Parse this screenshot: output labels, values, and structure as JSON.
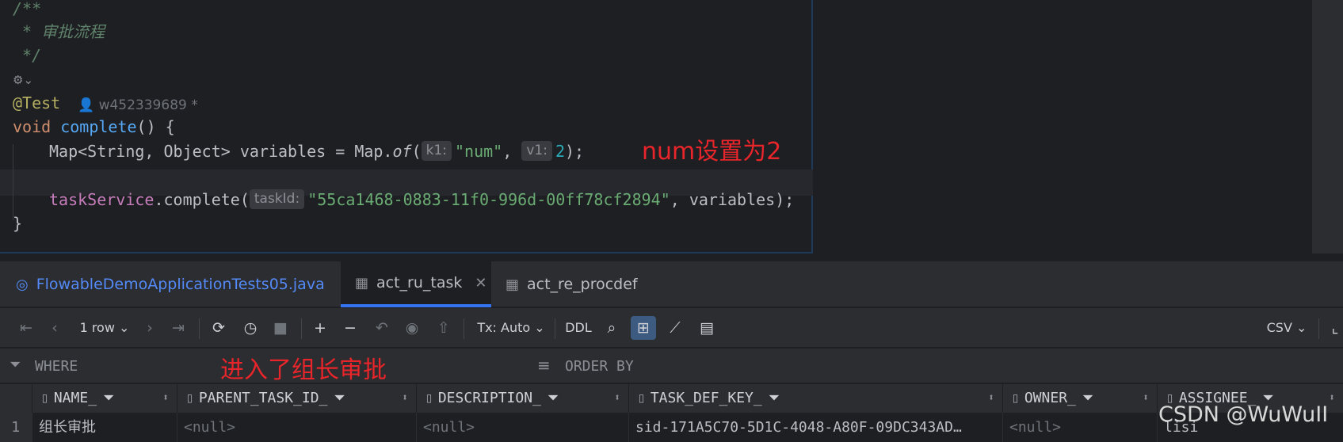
{
  "editor": {
    "comment_lines": [
      "/**",
      " * 审批流程",
      " */"
    ],
    "annotation": "@Test",
    "author": "w452339689 *",
    "signature": {
      "kw": "void",
      "name": "complete",
      "rest": "() {"
    },
    "line_map": {
      "type": "Map<String, Object> variables = Map.",
      "method": "of",
      "paren": "(",
      "hint_k": "k1:",
      "key": "\"num\"",
      "comma": ",",
      "hint_v": "v1:",
      "value": "2",
      "end": ");"
    },
    "line_complete": {
      "field": "taskService",
      "call": ".complete(",
      "hint": "taskId:",
      "arg": "\"55ca1468-0883-11f0-996d-00ff78cf2894\"",
      "end": ", variables);"
    },
    "closing": "}"
  },
  "annotations": {
    "num": "num设置为2",
    "task": "进入了组长审批"
  },
  "tabs": [
    {
      "label": "FlowableDemoApplicationTests05.java",
      "icon": "java-class-icon"
    },
    {
      "label": "act_ru_task",
      "icon": "table-icon",
      "active": true
    },
    {
      "label": "act_re_procdef",
      "icon": "table-icon"
    }
  ],
  "toolbar": {
    "rows": "1 row",
    "tx": "Tx: Auto",
    "ddl": "DDL",
    "export": "CSV"
  },
  "filter": {
    "where": "WHERE",
    "order_by": "ORDER BY"
  },
  "grid": {
    "columns": [
      "NAME_",
      "PARENT_TASK_ID_",
      "DESCRIPTION_",
      "TASK_DEF_KEY_",
      "OWNER_",
      "ASSIGNEE_"
    ],
    "row_number": "1",
    "row": [
      "组长审批",
      "<null>",
      "<null>",
      "sid-171A5C70-5D1C-4048-A80F-09DC343AD…",
      "<null>",
      "lisi"
    ]
  },
  "watermark": "CSDN @WuWuII",
  "colors": {
    "accent": "#3574f0",
    "annotation_red": "#e8252a",
    "background": "#1e1f22"
  }
}
